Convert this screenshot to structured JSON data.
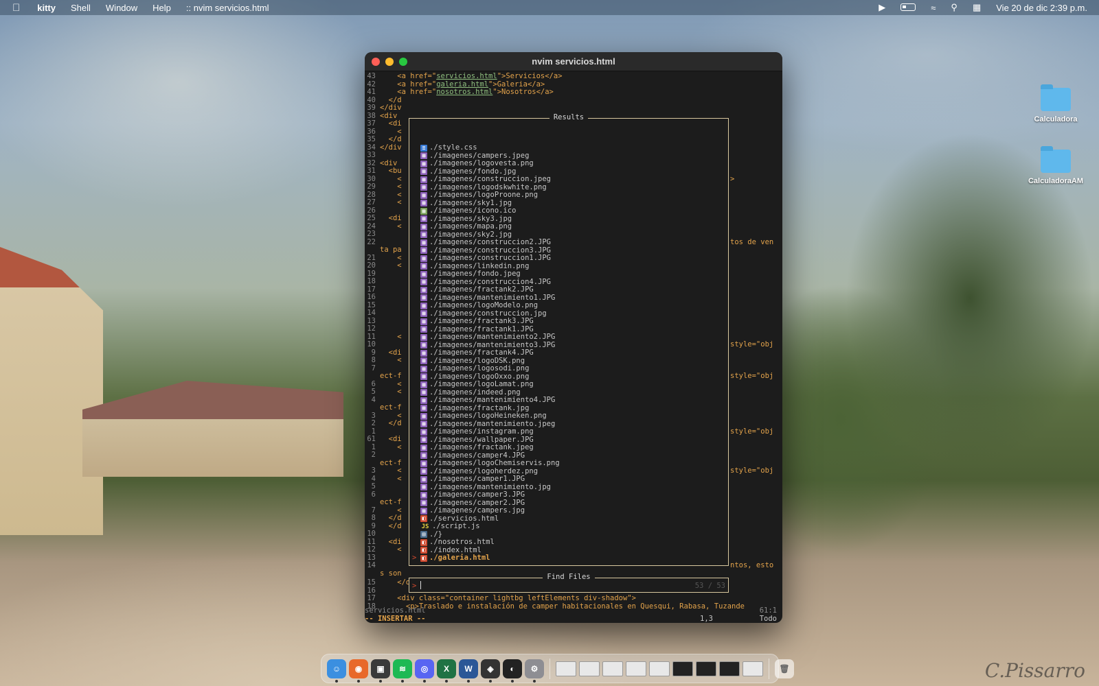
{
  "menubar": {
    "app": "kitty",
    "items": [
      "Shell",
      "Window",
      "Help"
    ],
    "window_label": ":: nvim servicios.html",
    "datetime": "Vie 20 de dic  2:39 p.m."
  },
  "desktop": {
    "icons": [
      {
        "label": "Calculadora"
      },
      {
        "label": "CalculadoraAM"
      }
    ]
  },
  "window": {
    "title": "nvim servicios.html"
  },
  "editor": {
    "top_lines": [
      {
        "n": "43",
        "pre": "    <a href=\"",
        "link": "servicios.html",
        "post": "\">Servicios</a>"
      },
      {
        "n": "42",
        "pre": "    <a href=\"",
        "link": "galeria.html",
        "post": "\">Galeria</a>"
      },
      {
        "n": "41",
        "pre": "    <a href=\"",
        "link": "nosotros.html",
        "post": "\">Nosotros</a>"
      }
    ],
    "side_lines": [
      {
        "n": "40",
        "t": "  </d"
      },
      {
        "n": "39",
        "t": "</div"
      },
      {
        "n": "38",
        "t": "<div"
      },
      {
        "n": "37",
        "t": "  <di"
      },
      {
        "n": "36",
        "t": "    <"
      },
      {
        "n": "35",
        "t": "  </d"
      },
      {
        "n": "34",
        "t": "</div"
      },
      {
        "n": "33",
        "t": ""
      },
      {
        "n": "32",
        "t": "<div"
      },
      {
        "n": "31",
        "t": "  <bu"
      },
      {
        "n": "30",
        "t": "    <"
      },
      {
        "n": "29",
        "t": "    <"
      },
      {
        "n": "28",
        "t": "    <"
      },
      {
        "n": "27",
        "t": "    <"
      },
      {
        "n": "26",
        "t": ""
      },
      {
        "n": "25",
        "t": "  <di"
      },
      {
        "n": "24",
        "t": "    <"
      },
      {
        "n": "23",
        "t": ""
      },
      {
        "n": "22",
        "t": ""
      },
      {
        "n": "",
        "t": "ta pa"
      },
      {
        "n": "21",
        "t": "    <"
      },
      {
        "n": "20",
        "t": "    <"
      },
      {
        "n": "19",
        "t": ""
      },
      {
        "n": "18",
        "t": ""
      },
      {
        "n": "17",
        "t": ""
      },
      {
        "n": "16",
        "t": ""
      },
      {
        "n": "15",
        "t": ""
      },
      {
        "n": "14",
        "t": ""
      },
      {
        "n": "13",
        "t": ""
      },
      {
        "n": "12",
        "t": ""
      },
      {
        "n": "11",
        "t": "    <"
      },
      {
        "n": "10",
        "t": ""
      },
      {
        "n": "9",
        "t": "  <di"
      },
      {
        "n": "8",
        "t": "    <"
      },
      {
        "n": "7",
        "t": ""
      },
      {
        "n": "",
        "t": "ect-f"
      },
      {
        "n": "6",
        "t": "    <"
      },
      {
        "n": "5",
        "t": "    <"
      },
      {
        "n": "4",
        "t": ""
      },
      {
        "n": "",
        "t": "ect-f"
      },
      {
        "n": "3",
        "t": "    <"
      },
      {
        "n": "2",
        "t": "  </d"
      },
      {
        "n": "1",
        "t": ""
      },
      {
        "n": "61",
        "t": "  <di"
      },
      {
        "n": "1",
        "t": "    <"
      },
      {
        "n": "2",
        "t": ""
      },
      {
        "n": "",
        "t": "ect-f"
      },
      {
        "n": "3",
        "t": "    <"
      },
      {
        "n": "4",
        "t": "    <"
      },
      {
        "n": "5",
        "t": ""
      },
      {
        "n": "6",
        "t": ""
      },
      {
        "n": "",
        "t": "ect-f"
      },
      {
        "n": "7",
        "t": "    <"
      },
      {
        "n": "8",
        "t": "  </d"
      },
      {
        "n": "9",
        "t": "  </d"
      },
      {
        "n": "10",
        "t": ""
      },
      {
        "n": "11",
        "t": "  <di"
      },
      {
        "n": "12",
        "t": "    <"
      },
      {
        "n": "13",
        "t": ""
      },
      {
        "n": "14",
        "t": ""
      },
      {
        "n": "",
        "t": "s son"
      }
    ],
    "right_fragments": [
      {
        "row": 10,
        "t": ">"
      },
      {
        "row": 18,
        "t": "tos de ven"
      },
      {
        "row": 31,
        "t": "style=\"obj"
      },
      {
        "row": 35,
        "t": "style=\"obj"
      },
      {
        "row": 42,
        "t": "style=\"obj"
      },
      {
        "row": 47,
        "t": "style=\"obj"
      },
      {
        "row": 59,
        "t": "ntos, esto"
      }
    ],
    "bottom_lines": [
      {
        "n": "15",
        "t": "    </div>"
      },
      {
        "n": "16",
        "t": ""
      },
      {
        "n": "17",
        "t": "    <div class=\"container lightbg leftElements div-shadow\">"
      },
      {
        "n": "18",
        "t": "      <p>Traslado e instalación de camper habitacionales en Quesqui, Rabasa, Tuzande"
      }
    ],
    "status_file": "servicios.html",
    "status_right": "61:1",
    "mode": "-- INSERTAR --",
    "cursor_pos": "1,3",
    "scroll_pct": "Todo"
  },
  "telescope": {
    "results_title": "Results",
    "find_title": "Find Files",
    "prompt_symbol": ">",
    "query": "",
    "count": "53 / 53",
    "results": [
      {
        "name": "./style.css",
        "kind": "css"
      },
      {
        "name": "./imagenes/campers.jpeg",
        "kind": "img"
      },
      {
        "name": "./imagenes/logovesta.png",
        "kind": "img"
      },
      {
        "name": "./imagenes/fondo.jpg",
        "kind": "img"
      },
      {
        "name": "./imagenes/construccion.jpeg",
        "kind": "img"
      },
      {
        "name": "./imagenes/logodskwhite.png",
        "kind": "img"
      },
      {
        "name": "./imagenes/logoProone.png",
        "kind": "img"
      },
      {
        "name": "./imagenes/sky1.jpg",
        "kind": "img"
      },
      {
        "name": "./imagenes/icono.ico",
        "kind": "ico"
      },
      {
        "name": "./imagenes/sky3.jpg",
        "kind": "img"
      },
      {
        "name": "./imagenes/mapa.png",
        "kind": "img"
      },
      {
        "name": "./imagenes/sky2.jpg",
        "kind": "img"
      },
      {
        "name": "./imagenes/construccion2.JPG",
        "kind": "img"
      },
      {
        "name": "./imagenes/construccion3.JPG",
        "kind": "img"
      },
      {
        "name": "./imagenes/construccion1.JPG",
        "kind": "img"
      },
      {
        "name": "./imagenes/linkedin.png",
        "kind": "img"
      },
      {
        "name": "./imagenes/fondo.jpeg",
        "kind": "img"
      },
      {
        "name": "./imagenes/construccion4.JPG",
        "kind": "img"
      },
      {
        "name": "./imagenes/fractank2.JPG",
        "kind": "img"
      },
      {
        "name": "./imagenes/mantenimiento1.JPG",
        "kind": "img"
      },
      {
        "name": "./imagenes/logoModelo.png",
        "kind": "img"
      },
      {
        "name": "./imagenes/construccion.jpg",
        "kind": "img"
      },
      {
        "name": "./imagenes/fractank3.JPG",
        "kind": "img"
      },
      {
        "name": "./imagenes/fractank1.JPG",
        "kind": "img"
      },
      {
        "name": "./imagenes/mantenimiento2.JPG",
        "kind": "img"
      },
      {
        "name": "./imagenes/mantenimiento3.JPG",
        "kind": "img"
      },
      {
        "name": "./imagenes/fractank4.JPG",
        "kind": "img"
      },
      {
        "name": "./imagenes/logoDSK.png",
        "kind": "img"
      },
      {
        "name": "./imagenes/logosodi.png",
        "kind": "img"
      },
      {
        "name": "./imagenes/logoOxxo.png",
        "kind": "img"
      },
      {
        "name": "./imagenes/logoLamat.png",
        "kind": "img"
      },
      {
        "name": "./imagenes/indeed.png",
        "kind": "img"
      },
      {
        "name": "./imagenes/mantenimiento4.JPG",
        "kind": "img"
      },
      {
        "name": "./imagenes/fractank.jpg",
        "kind": "img"
      },
      {
        "name": "./imagenes/logoHeineken.png",
        "kind": "img"
      },
      {
        "name": "./imagenes/mantenimiento.jpeg",
        "kind": "img"
      },
      {
        "name": "./imagenes/instagram.png",
        "kind": "img"
      },
      {
        "name": "./imagenes/wallpaper.JPG",
        "kind": "img"
      },
      {
        "name": "./imagenes/fractank.jpeg",
        "kind": "img"
      },
      {
        "name": "./imagenes/camper4.JPG",
        "kind": "img"
      },
      {
        "name": "./imagenes/logoChemiservis.png",
        "kind": "img"
      },
      {
        "name": "./imagenes/logoherdez.png",
        "kind": "img"
      },
      {
        "name": "./imagenes/camper1.JPG",
        "kind": "img"
      },
      {
        "name": "./imagenes/mantenimiento.jpg",
        "kind": "img"
      },
      {
        "name": "./imagenes/camper3.JPG",
        "kind": "img"
      },
      {
        "name": "./imagenes/camper2.JPG",
        "kind": "img"
      },
      {
        "name": "./imagenes/campers.jpg",
        "kind": "img"
      },
      {
        "name": "./servicios.html",
        "kind": "html"
      },
      {
        "name": "./script.js",
        "kind": "js"
      },
      {
        "name": "./}",
        "kind": "dir"
      },
      {
        "name": "./nosotros.html",
        "kind": "html"
      },
      {
        "name": "./index.html",
        "kind": "html"
      },
      {
        "name": "./galeria.html",
        "kind": "html",
        "selected": true
      }
    ]
  },
  "dock": {
    "apps": [
      {
        "name": "finder",
        "color": "#3b8fe0",
        "glyph": "☺"
      },
      {
        "name": "firefox",
        "color": "#e8692a",
        "glyph": "◉"
      },
      {
        "name": "kitty",
        "color": "#3a3a3a",
        "glyph": "▣"
      },
      {
        "name": "spotify",
        "color": "#1db954",
        "glyph": "≋"
      },
      {
        "name": "discord",
        "color": "#5865f2",
        "glyph": "◎"
      },
      {
        "name": "excel",
        "color": "#1f7244",
        "glyph": "X"
      },
      {
        "name": "word",
        "color": "#2b5797",
        "glyph": "W"
      },
      {
        "name": "davinci-resolve",
        "color": "#333333",
        "glyph": "◈"
      },
      {
        "name": "obs",
        "color": "#222222",
        "glyph": "◐"
      },
      {
        "name": "system-settings",
        "color": "#8e8e93",
        "glyph": "⚙"
      }
    ],
    "thumbnails": 9
  },
  "colors": {
    "accent": "#e3a34b",
    "border": "#d9c9a0",
    "prompt": "#d0492f"
  }
}
